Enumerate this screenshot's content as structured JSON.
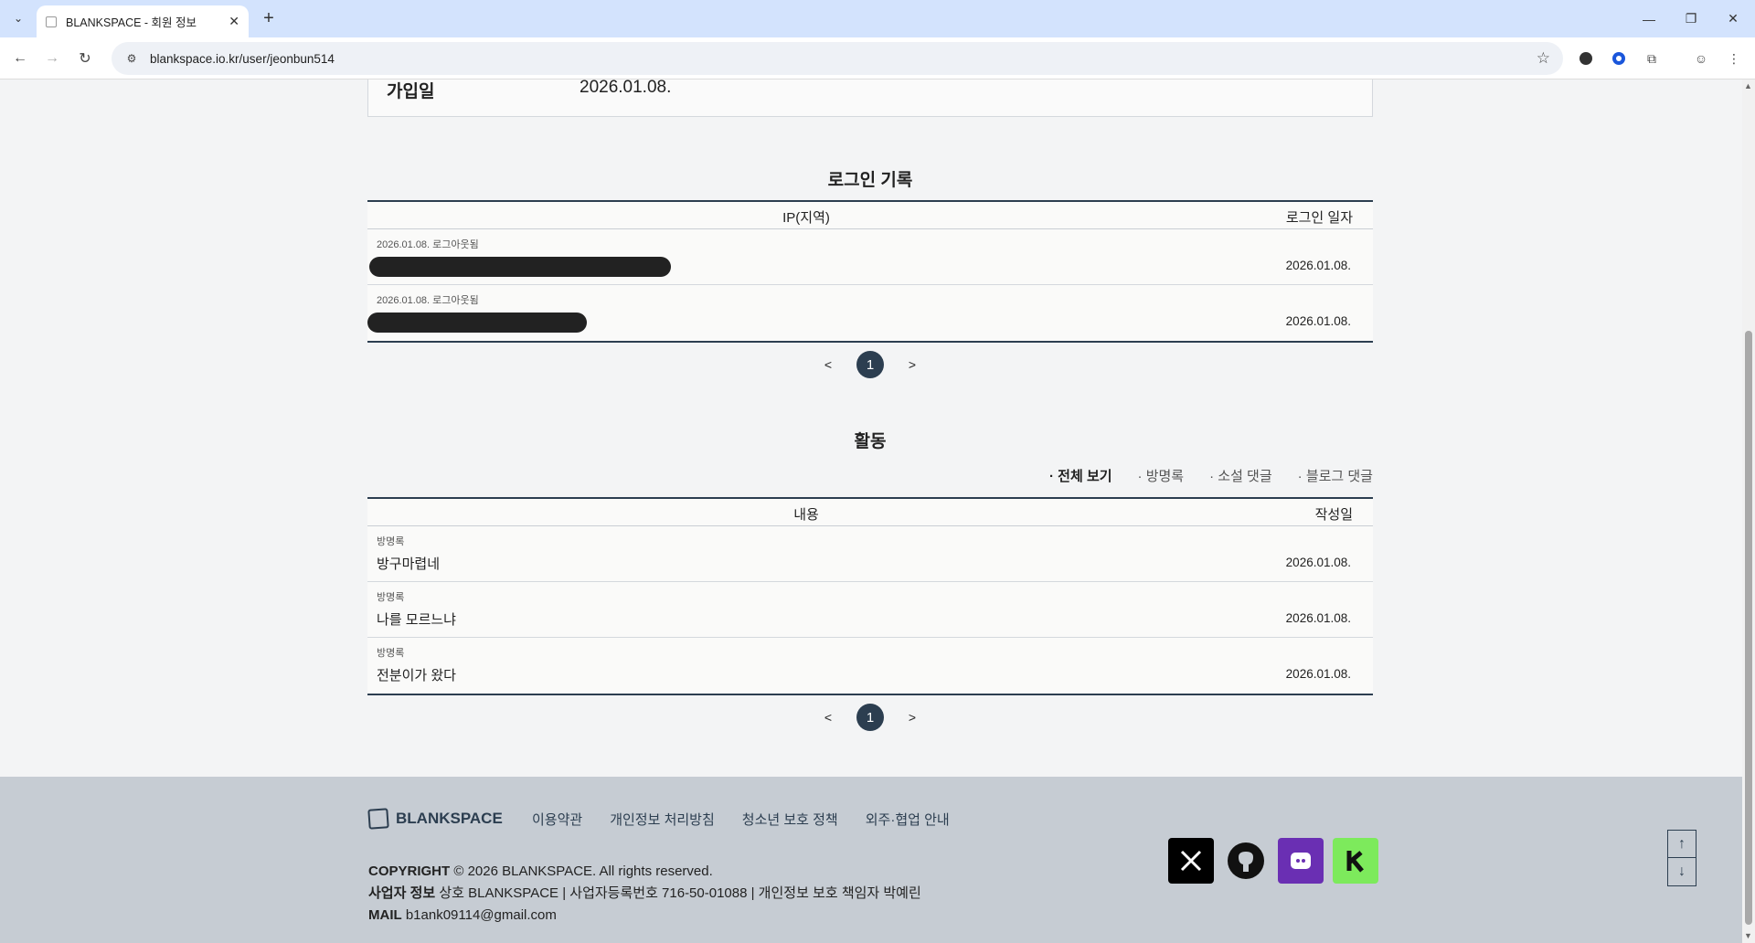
{
  "browser": {
    "tab_title": "BLANKSPACE - 회원 정보",
    "url": "blankspace.io.kr/user/jeonbun514"
  },
  "profile": {
    "joined_label": "가입일",
    "joined_value": "2026.01.08."
  },
  "login_history": {
    "title": "로그인 기록",
    "columns": [
      "IP(지역)",
      "로그인 일자"
    ],
    "rows": [
      {
        "meta": "2026.01.08. 로그아웃됨",
        "date": "2026.01.08."
      },
      {
        "meta": "2026.01.08. 로그아웃됨",
        "date": "2026.01.08."
      }
    ],
    "pager": {
      "prev": "<",
      "page": "1",
      "next": ">"
    }
  },
  "activity": {
    "title": "활동",
    "filters": [
      "· 전체 보기",
      "· 방명록",
      "· 소설 댓글",
      "· 블로그 댓글"
    ],
    "active_filter": "· 전체 보기",
    "columns": [
      "내용",
      "작성일"
    ],
    "rows": [
      {
        "category": "방명록",
        "content": "방구마렵네",
        "date": "2026.01.08."
      },
      {
        "category": "방명록",
        "content": "나를 모르느냐",
        "date": "2026.01.08."
      },
      {
        "category": "방명록",
        "content": "전분이가 왔다",
        "date": "2026.01.08."
      }
    ],
    "pager": {
      "prev": "<",
      "page": "1",
      "next": ">"
    }
  },
  "footer": {
    "logo": "BLANKSPACE",
    "links": [
      "이용약관",
      "개인정보 처리방침",
      "청소년 보호 정책",
      "외주·협업 안내"
    ],
    "copyright_label": "COPYRIGHT",
    "copyright_text": "© 2026 BLANKSPACE. All rights reserved.",
    "business_label": "사업자 정보",
    "business_text": "상호 BLANKSPACE | 사업자등록번호 716-50-01088 | 개인정보 보호 책임자 박예린",
    "mail_label": "MAIL",
    "mail_text": "b1ank09114@gmail.com",
    "socials": [
      "x-icon",
      "github-icon",
      "postype-icon",
      "kakao-icon"
    ],
    "colors": {
      "footer_bg": "#c6ccd3",
      "accent": "#2c3e50",
      "postype": "#6a2fb3",
      "kakao": "#7dea5c"
    }
  }
}
